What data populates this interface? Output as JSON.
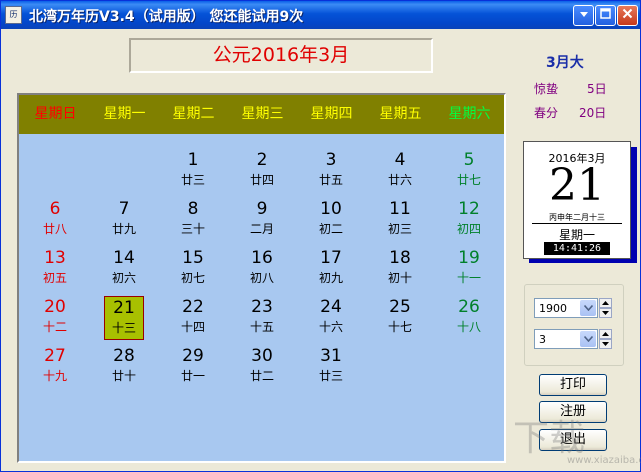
{
  "window": {
    "title": "北湾万年历V3.4（试用版） 您还能试用9次",
    "app_icon_glyph": "历",
    "controls": {
      "minimize": "minimize-icon",
      "maximize": "maximize-icon",
      "close": "close-icon"
    }
  },
  "header": {
    "month_title": "公元2016年3月"
  },
  "weekdays": [
    "星期日",
    "星期一",
    "星期二",
    "星期三",
    "星期四",
    "星期五",
    "星期六"
  ],
  "calendar": {
    "weeks": [
      [
        null,
        null,
        {
          "n": "1",
          "l": "廿三"
        },
        {
          "n": "2",
          "l": "廿四"
        },
        {
          "n": "3",
          "l": "廿五"
        },
        {
          "n": "4",
          "l": "廿六"
        },
        {
          "n": "5",
          "l": "廿七"
        }
      ],
      [
        {
          "n": "6",
          "l": "廿八"
        },
        {
          "n": "7",
          "l": "廿九"
        },
        {
          "n": "8",
          "l": "三十"
        },
        {
          "n": "9",
          "l": "二月"
        },
        {
          "n": "10",
          "l": "初二"
        },
        {
          "n": "11",
          "l": "初三"
        },
        {
          "n": "12",
          "l": "初四"
        }
      ],
      [
        {
          "n": "13",
          "l": "初五"
        },
        {
          "n": "14",
          "l": "初六"
        },
        {
          "n": "15",
          "l": "初七"
        },
        {
          "n": "16",
          "l": "初八"
        },
        {
          "n": "17",
          "l": "初九"
        },
        {
          "n": "18",
          "l": "初十"
        },
        {
          "n": "19",
          "l": "十一"
        }
      ],
      [
        {
          "n": "20",
          "l": "十二"
        },
        {
          "n": "21",
          "l": "十三",
          "today": true
        },
        {
          "n": "22",
          "l": "十四"
        },
        {
          "n": "23",
          "l": "十五"
        },
        {
          "n": "24",
          "l": "十六"
        },
        {
          "n": "25",
          "l": "十七"
        },
        {
          "n": "26",
          "l": "十八"
        }
      ],
      [
        {
          "n": "27",
          "l": "十九"
        },
        {
          "n": "28",
          "l": "廿十"
        },
        {
          "n": "29",
          "l": "廿一"
        },
        {
          "n": "30",
          "l": "廿二"
        },
        {
          "n": "31",
          "l": "廿三"
        },
        null,
        null
      ]
    ]
  },
  "side": {
    "month_label": "3月大",
    "solar_terms": [
      {
        "name": "惊蛰",
        "day": "5日"
      },
      {
        "name": "春分",
        "day": "20日"
      }
    ]
  },
  "day_card": {
    "year_month": "2016年3月",
    "day": "21",
    "lunar": "丙申年二月十三",
    "weekday": "星期一",
    "time": "14:41:26"
  },
  "selectors": {
    "year": {
      "value": "1900"
    },
    "month": {
      "value": "3"
    }
  },
  "buttons": {
    "print": "打印",
    "register": "注册",
    "exit": "退出"
  },
  "watermark": {
    "logo": "下载",
    "site": "www.xiazaiba.com"
  },
  "colors": {
    "title_bar": "#0553d8",
    "weekday_bar": "#808000",
    "calendar_bg": "#a8c8f0",
    "sunday": "#e00000",
    "saturday": "#00802a",
    "today_bg": "#a8c000",
    "time_bg": "#000000"
  }
}
